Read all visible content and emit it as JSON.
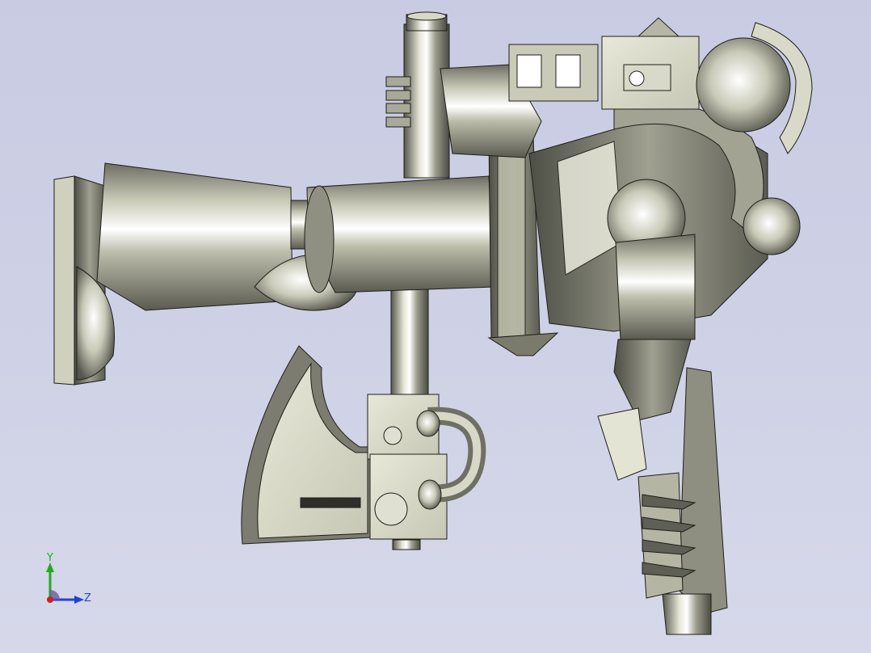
{
  "viewport": {
    "background_top": "#c9cbe3",
    "background_bottom": "#d6d8ea",
    "model": {
      "parts": [
        "muzzle-flange",
        "barrel-rear-section",
        "barrel-front-section",
        "barrel-coupler-ring",
        "receiver-body",
        "scope-mount-housing",
        "scope-sphere",
        "vertical-support-rod",
        "axe-head",
        "axe-clamp-block",
        "hose-loop",
        "pistol-grip",
        "grip-teeth"
      ],
      "colors": {
        "metal_light": "#e6e6d6",
        "metal_mid": "#b9baa8",
        "metal_dark": "#6b6c60",
        "edge": "#1e1e1a"
      }
    },
    "triad": {
      "y_label": "Y",
      "z_label": "Z",
      "colors": {
        "y": "#22aa22",
        "z": "#2244cc",
        "x": "#cc2222"
      },
      "icon": "coordinate-triad-icon"
    }
  }
}
